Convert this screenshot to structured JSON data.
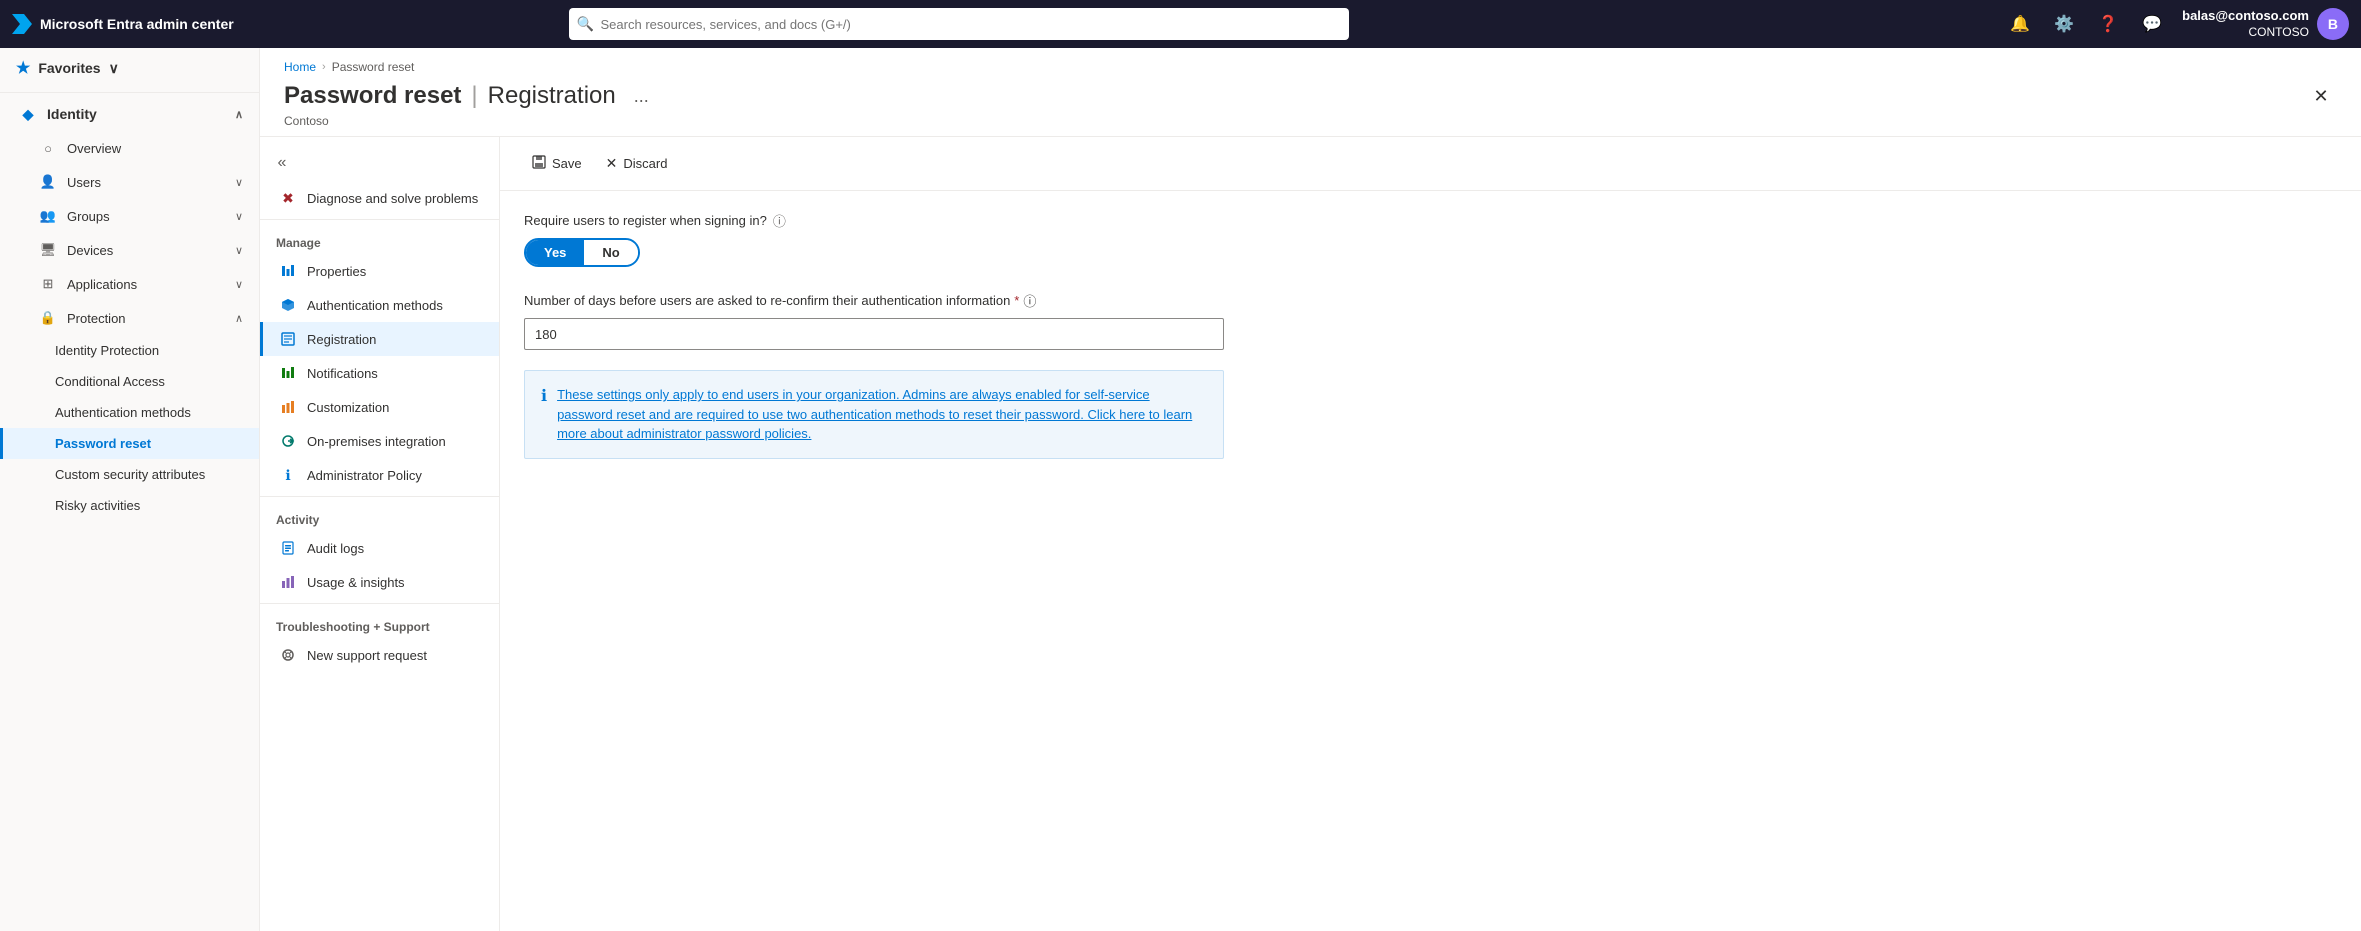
{
  "app": {
    "brand": "Microsoft Entra admin center",
    "search_placeholder": "Search resources, services, and docs (G+/)"
  },
  "user": {
    "email": "balas@contoso.com",
    "org": "CONTOSO",
    "initials": "B"
  },
  "sidebar": {
    "favorites_label": "Favorites",
    "items": [
      {
        "id": "identity",
        "label": "Identity",
        "icon": "diamond",
        "expandable": true,
        "expanded": true
      },
      {
        "id": "overview",
        "label": "Overview",
        "icon": "circle",
        "indent": true
      },
      {
        "id": "users",
        "label": "Users",
        "icon": "person",
        "indent": true,
        "expandable": true
      },
      {
        "id": "groups",
        "label": "Groups",
        "icon": "group",
        "indent": true,
        "expandable": true
      },
      {
        "id": "devices",
        "label": "Devices",
        "icon": "device",
        "indent": true,
        "expandable": true
      },
      {
        "id": "applications",
        "label": "Applications",
        "icon": "app",
        "indent": true,
        "expandable": true
      },
      {
        "id": "protection",
        "label": "Protection",
        "icon": "shield",
        "indent": true,
        "expandable": true,
        "expanded": true
      },
      {
        "id": "identity-protection",
        "label": "Identity Protection",
        "sub": true
      },
      {
        "id": "conditional-access",
        "label": "Conditional Access",
        "sub": true
      },
      {
        "id": "authentication-methods",
        "label": "Authentication methods",
        "sub": true
      },
      {
        "id": "password-reset",
        "label": "Password reset",
        "sub": true,
        "active": true
      },
      {
        "id": "custom-security-attributes",
        "label": "Custom security attributes",
        "sub": true
      },
      {
        "id": "risky-activities",
        "label": "Risky activities",
        "sub": true
      }
    ]
  },
  "breadcrumb": {
    "home": "Home",
    "current": "Password reset"
  },
  "page": {
    "title": "Password reset",
    "separator": "|",
    "subtitle": "Registration",
    "more_label": "...",
    "org": "Contoso"
  },
  "secondary_nav": {
    "diagnose_label": "Diagnose and solve problems",
    "manage_label": "Manage",
    "items": [
      {
        "id": "properties",
        "label": "Properties",
        "icon": "bar-chart"
      },
      {
        "id": "authentication-methods",
        "label": "Authentication methods",
        "icon": "shield-check"
      },
      {
        "id": "registration",
        "label": "Registration",
        "icon": "list",
        "active": true
      },
      {
        "id": "notifications",
        "label": "Notifications",
        "icon": "bell"
      },
      {
        "id": "customization",
        "label": "Customization",
        "icon": "bar-chart-color"
      },
      {
        "id": "on-premises",
        "label": "On-premises integration",
        "icon": "sync"
      },
      {
        "id": "admin-policy",
        "label": "Administrator Policy",
        "icon": "info"
      }
    ],
    "activity_label": "Activity",
    "activity_items": [
      {
        "id": "audit-logs",
        "label": "Audit logs",
        "icon": "audit"
      },
      {
        "id": "usage-insights",
        "label": "Usage & insights",
        "icon": "insights"
      }
    ],
    "troubleshooting_label": "Troubleshooting + Support",
    "support_items": [
      {
        "id": "new-support",
        "label": "New support request",
        "icon": "support"
      }
    ]
  },
  "toolbar": {
    "save_label": "Save",
    "discard_label": "Discard"
  },
  "form": {
    "require_register_label": "Require users to register when signing in?",
    "yes_label": "Yes",
    "no_label": "No",
    "days_label": "Number of days before users are asked to re-confirm their authentication information",
    "days_value": "180",
    "info_text": "These settings only apply to end users in your organization. Admins are always enabled for self-service password reset and are required to use two authentication methods to reset their password. Click here to learn more about administrator password policies."
  }
}
